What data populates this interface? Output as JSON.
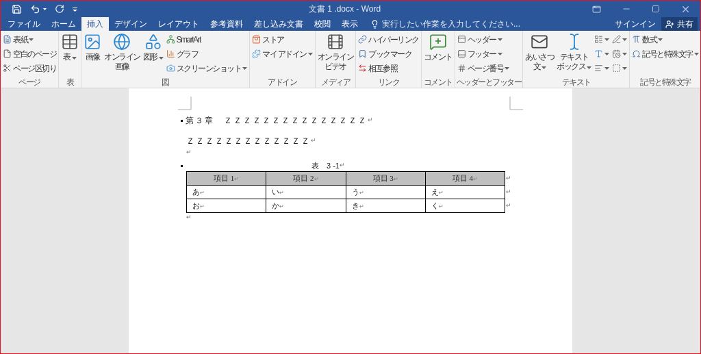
{
  "window": {
    "title": "文書 1 .docx - Word"
  },
  "tabs": [
    {
      "label": "ファイル",
      "selected": false
    },
    {
      "label": "ホーム",
      "selected": false
    },
    {
      "label": "挿入",
      "selected": true
    },
    {
      "label": "デザイン",
      "selected": false
    },
    {
      "label": "レイアウト",
      "selected": false
    },
    {
      "label": "参考資料",
      "selected": false
    },
    {
      "label": "差し込み文書",
      "selected": false
    },
    {
      "label": "校閲",
      "selected": false
    },
    {
      "label": "表示",
      "selected": false
    }
  ],
  "tell_me": {
    "placeholder": "実行したい作業を入力してください..."
  },
  "sign_in": "サインイン",
  "share": "共有",
  "ribbon": [
    {
      "label": "ページ",
      "columns": [
        {
          "kind": "stack",
          "items": [
            {
              "label": "表紙",
              "dropdown": true
            },
            {
              "label": "空白のページ",
              "dropdown": false
            },
            {
              "label": "ページ区切り",
              "dropdown": false
            }
          ]
        }
      ]
    },
    {
      "label": "表",
      "columns": [
        {
          "kind": "large",
          "lines": [
            "表"
          ],
          "dropdown": true
        }
      ]
    },
    {
      "label": "図",
      "columns": [
        {
          "kind": "large",
          "lines": [
            "画像"
          ],
          "dropdown": false
        },
        {
          "kind": "large",
          "lines": [
            "オンライン",
            "画像"
          ],
          "dropdown": false
        },
        {
          "kind": "large",
          "lines": [
            "図形"
          ],
          "dropdown": true
        },
        {
          "kind": "stack",
          "items": [
            {
              "label": "SmartArt",
              "dropdown": false
            },
            {
              "label": "グラフ",
              "dropdown": false
            },
            {
              "label": "スクリーンショット",
              "dropdown": true
            }
          ]
        }
      ]
    },
    {
      "label": "アドイン",
      "columns": [
        {
          "kind": "stack",
          "items": [
            {
              "label": "ストア",
              "dropdown": false
            },
            {
              "label": "マイ アドイン",
              "dropdown": true
            }
          ]
        }
      ]
    },
    {
      "label": "メディア",
      "columns": [
        {
          "kind": "large",
          "lines": [
            "オンライン",
            "ビデオ"
          ],
          "dropdown": false
        }
      ]
    },
    {
      "label": "リンク",
      "columns": [
        {
          "kind": "stack",
          "items": [
            {
              "label": "ハイパーリンク",
              "dropdown": false
            },
            {
              "label": "ブックマーク",
              "dropdown": false
            },
            {
              "label": "相互参照",
              "dropdown": false
            }
          ]
        }
      ]
    },
    {
      "label": "コメント",
      "columns": [
        {
          "kind": "large",
          "lines": [
            "コメント"
          ],
          "dropdown": false
        }
      ]
    },
    {
      "label": "ヘッダーとフッター",
      "columns": [
        {
          "kind": "stack",
          "items": [
            {
              "label": "ヘッダー",
              "dropdown": true
            },
            {
              "label": "フッター",
              "dropdown": true
            },
            {
              "label": "ページ番号",
              "dropdown": true
            }
          ]
        }
      ]
    },
    {
      "label": "テキスト",
      "columns": [
        {
          "kind": "large",
          "lines": [
            "あいさつ",
            "文"
          ],
          "dropdown": true
        },
        {
          "kind": "large",
          "lines": [
            "テキスト",
            "ボックス"
          ],
          "dropdown": true
        },
        {
          "kind": "stack",
          "items": [
            {
              "dropdown": true
            },
            {
              "dropdown": true
            },
            {
              "dropdown": true
            }
          ]
        },
        {
          "kind": "stack",
          "items": [
            {
              "dropdown": true
            },
            {
              "dropdown": true
            },
            {
              "dropdown": true
            }
          ]
        }
      ]
    },
    {
      "label": "記号と特殊文字",
      "columns": [
        {
          "kind": "stack",
          "items": [
            {
              "label": "数式",
              "dropdown": true
            },
            {
              "label": "記号と特殊文字",
              "dropdown": true
            }
          ]
        }
      ]
    }
  ],
  "document": {
    "heading": {
      "text": "第３章　ＺＺＺＺＺＺＺＺＺＺＺＺＺＺＺ",
      "mark": "↵"
    },
    "paragraphs": [
      {
        "text": "ＺＺＺＺＺＺＺＺＺＺＺＺＺ",
        "mark": "↵"
      },
      {
        "mark": "↵"
      }
    ],
    "caption": {
      "text": "表　3 -1",
      "mark": "↵"
    },
    "table": {
      "columns": [
        {
          "text": "項目 1",
          "mark": "↵"
        },
        {
          "text": "項目 2",
          "mark": "↵"
        },
        {
          "text": "項目 3",
          "mark": "↵"
        },
        {
          "text": "項目 4",
          "mark": "↵"
        }
      ],
      "row_mark": "↵",
      "rows": [
        [
          {
            "text": "あ",
            "mark": "↵"
          },
          {
            "text": "い",
            "mark": "↵"
          },
          {
            "text": "う",
            "mark": "↵"
          },
          {
            "text": "え",
            "mark": "↵"
          }
        ],
        [
          {
            "text": "お",
            "mark": "↵"
          },
          {
            "text": "か",
            "mark": "↵"
          },
          {
            "text": "き",
            "mark": "↵"
          },
          {
            "text": "く",
            "mark": "↵"
          }
        ]
      ]
    },
    "after_table_mark": "↵"
  }
}
